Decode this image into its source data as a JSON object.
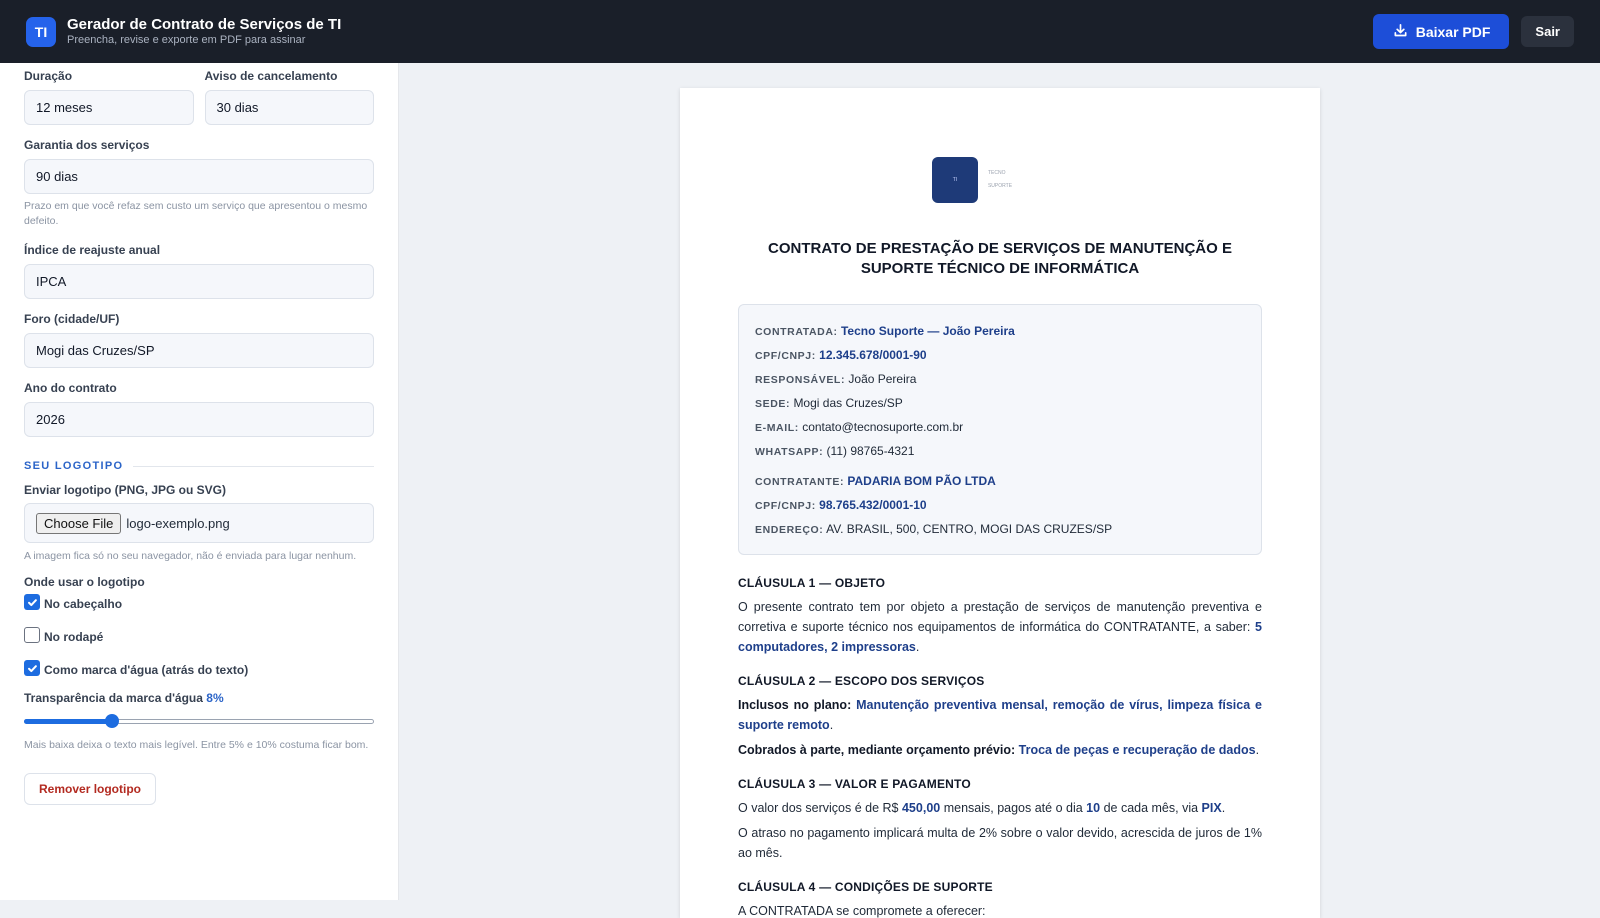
{
  "header": {
    "logo_text": "TI",
    "title": "Gerador de Contrato de Serviços de TI",
    "subtitle": "Preencha, revise e exporte em PDF para assinar",
    "download_label": "Baixar PDF",
    "logout_label": "Sair"
  },
  "form": {
    "duration": {
      "label": "Duração",
      "value": "12 meses"
    },
    "notice": {
      "label": "Aviso de cancelamento",
      "value": "30 dias"
    },
    "warranty": {
      "label": "Garantia dos serviços",
      "value": "90 dias",
      "hint": "Prazo em que você refaz sem custo um serviço que apresentou o mesmo defeito."
    },
    "index": {
      "label": "Índice de reajuste anual",
      "value": "IPCA"
    },
    "forum": {
      "label": "Foro (cidade/UF)",
      "value": "Mogi das Cruzes/SP"
    },
    "year": {
      "label": "Ano do contrato",
      "value": "2026"
    }
  },
  "logo_section": {
    "title": "SEU LOGOTIPO",
    "upload_label": "Enviar logotipo (PNG, JPG ou SVG)",
    "choose_label": "Choose File",
    "file_name": "logo-exemplo.png",
    "upload_hint": "A imagem fica só no seu navegador, não é enviada para lugar nenhum.",
    "where_label": "Onde usar o logotipo",
    "options": [
      {
        "label": "No cabeçalho",
        "checked": true
      },
      {
        "label": "No rodapé",
        "checked": false
      },
      {
        "label": "Como marca d'água (atrás do texto)",
        "checked": true
      }
    ],
    "transparency_label": "Transparência da marca d'água",
    "transparency_value": "8%",
    "transparency_fraction": 0.08,
    "transparency_hint": "Mais baixa deixa o texto mais legível. Entre 5% e 10% costuma ficar bom.",
    "remove_label": "Remover logotipo"
  },
  "doc": {
    "logo_mark": "TI",
    "logo_line1": "TECNO",
    "logo_line2": "SUPORTE",
    "title": "CONTRATO DE PRESTAÇÃO DE SERVIÇOS DE MANUTENÇÃO E SUPORTE TÉCNICO DE INFORMÁTICA",
    "contratada": {
      "k1": "CONTRATADA:",
      "v1": "Tecno Suporte — João Pereira",
      "k2": "CPF/CNPJ:",
      "v2": "12.345.678/0001-90",
      "k3": "RESPONSÁVEL:",
      "v3": "João Pereira",
      "k4": "SEDE:",
      "v4": "Mogi das Cruzes/SP",
      "k5": "E-MAIL:",
      "v5": "contato@tecnosuporte.com.br",
      "k6": "WHATSAPP:",
      "v6": "(11) 98765-4321"
    },
    "contratante": {
      "k1": "CONTRATANTE:",
      "v1": "PADARIA BOM PÃO LTDA",
      "k2": "CPF/CNPJ:",
      "v2": "98.765.432/0001-10",
      "k3": "ENDEREÇO:",
      "v3": "AV. BRASIL, 500, CENTRO, MOGI DAS CRUZES/SP"
    },
    "c1": {
      "title": "CLÁUSULA 1 — OBJETO",
      "text": "O presente contrato tem por objeto a prestação de serviços de manutenção preventiva e corretiva e suporte técnico nos equipamentos de informática do CONTRATANTE, a saber:",
      "equipment": "5 computadores, 2 impressoras",
      "end": "."
    },
    "c2": {
      "title": "CLÁUSULA 2 — ESCOPO DOS SERVIÇOS",
      "included_label": "Inclusos no plano:",
      "included": "Manutenção preventiva mensal, remoção de vírus, limpeza física e suporte remoto",
      "extra_label": "Cobrados à parte, mediante orçamento prévio:",
      "extra": "Troca de peças e recuperação de dados",
      "end": "."
    },
    "c3": {
      "title": "CLÁUSULA 3 — VALOR E PAGAMENTO",
      "t1": "O valor dos serviços é de R$",
      "amount": "450,00",
      "t2": "mensais, pagos até o dia",
      "day": "10",
      "t3": "de cada mês, via",
      "method": "PIX",
      "t4": ".",
      "late": "O atraso no pagamento implicará multa de 2% sobre o valor devido, acrescida de juros de 1% ao mês."
    },
    "c4": {
      "title": "CLÁUSULA 4 — CONDIÇÕES DE SUPORTE",
      "text": "A CONTRATADA se compromete a oferecer:"
    }
  }
}
